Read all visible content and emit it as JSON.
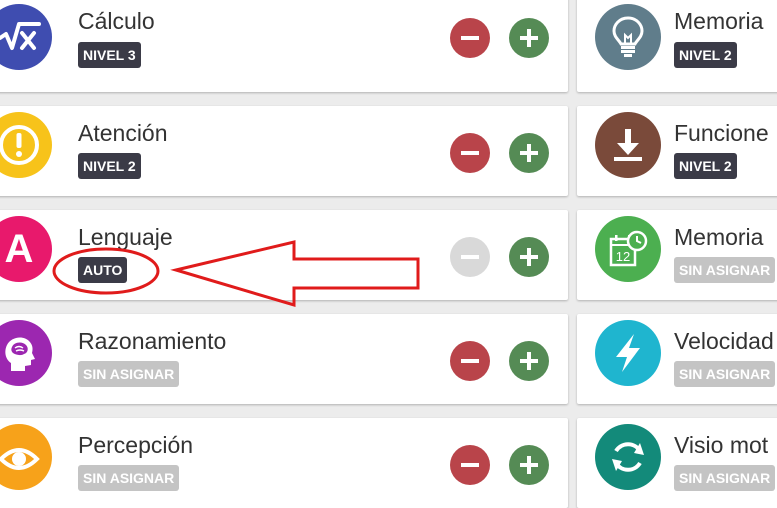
{
  "colors": {
    "calc": "#3f4db0",
    "atencion": "#f7c31a",
    "lenguaje": "#e8196c",
    "razonamiento": "#9c27b0",
    "percepcion": "#f7a21a",
    "memoria": "#607d8b",
    "funciones": "#7a4a3a",
    "memoria2": "#4caf50",
    "velocidad": "#1fb5cf",
    "visio": "#138a7a",
    "minus_active": "#b9444a",
    "minus_disabled": "#d9d9d9",
    "plus": "#558b55",
    "annotation": "#e01b1b"
  },
  "left_column": [
    {
      "title": "Cálculo",
      "badge": "NIVEL 3",
      "icon": "square-root-icon"
    },
    {
      "title": "Atención",
      "badge": "NIVEL 2",
      "icon": "exclamation-icon"
    },
    {
      "title": "Lenguaje",
      "badge": "AUTO",
      "icon": "letter-a-icon"
    },
    {
      "title": "Razonamiento",
      "badge": "SIN ASIGNAR",
      "icon": "brain-head-icon"
    },
    {
      "title": "Percepción",
      "badge": "SIN ASIGNAR",
      "icon": "eye-icon"
    }
  ],
  "right_column": [
    {
      "title": "Memoria",
      "badge": "NIVEL 2",
      "icon": "lightbulb-icon"
    },
    {
      "title": "Funcione",
      "badge": "NIVEL 2",
      "icon": "download-icon"
    },
    {
      "title": "Memoria",
      "badge": "SIN ASIGNAR",
      "icon": "calendar-clock-icon",
      "calendar_day": "12"
    },
    {
      "title": "Velocidad",
      "badge": "SIN ASIGNAR",
      "icon": "lightning-icon"
    },
    {
      "title": "Visio mot",
      "badge": "SIN ASIGNAR",
      "icon": "rotate-arrows-icon"
    }
  ]
}
